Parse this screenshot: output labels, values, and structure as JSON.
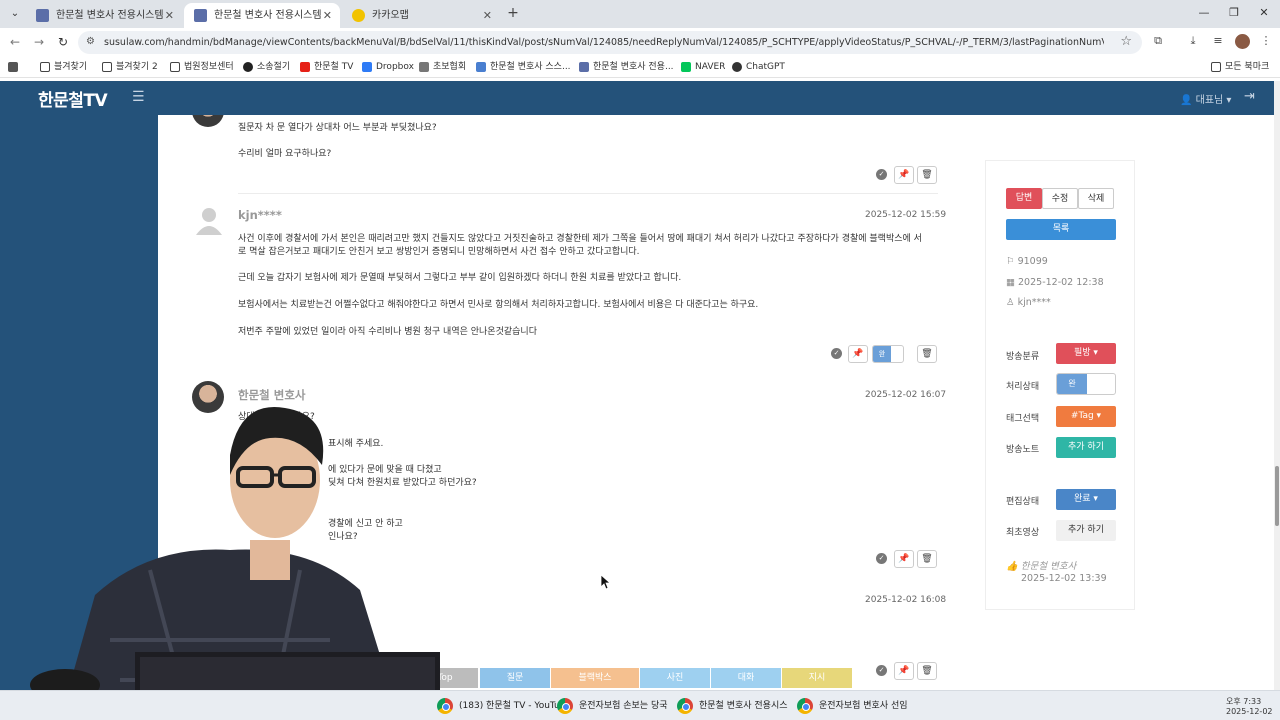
{
  "browser": {
    "tabs": [
      {
        "label": "한문철 변호사 전용시스템",
        "active": false
      },
      {
        "label": "한문철 변호사 전용시스템",
        "active": true
      },
      {
        "label": "카카오맵",
        "active": false
      }
    ],
    "url": "susulaw.com/handmin/bdManage/viewContents/backMenuVal/B/bdSelVal/11/thisKindVal/post/sNumVal/124085/needReplyNumVal/124085/P_SCHTYPE/applyVideoStatus/P_SCHVAL/-/P_TERM/3/lastPaginationNumVal/1",
    "bookmarks": [
      "블겨찾기",
      "블겨찾기 2",
      "법원정보센터",
      "소송절기",
      "한문철 TV",
      "Dropbox",
      "초보협회",
      "한문철 변호사 스스...",
      "한문철 변호사 전용...",
      "NAVER",
      "ChatGPT"
    ],
    "bookmarks_right": "모든 북마크"
  },
  "site": {
    "logo": "한문철TV",
    "user": "대표님 ▾"
  },
  "comments": {
    "prev": {
      "lines": [
        "질문자 차 문 열다가 상대차 어느 부분과 부딪쳤나요?",
        "수리비 얼마 요구하나요?"
      ]
    },
    "c1": {
      "author": "kjn****",
      "date": "2025-12-02 15:59",
      "lines": [
        "사건 이후에 경찰서에 가서 본인은 때리려고만 했지 건들지도 않았다고 거짓진술하고 경찰한테 제가 그쪽을 들어서 땅에 패대기 쳐서 허리가 나갔다고 주장하다가 경찰에 블랙박스에 서",
        "로 멱살 잡은거보고 패대기도 안친거 보고 쌍방인거 증명되니 민망해하면서 사건 접수 안하고 갔다고합니다.",
        "근데 오늘 갑자기 보험사에 제가 문열때 부딪혀서 그렇다고 부부 같이 입원하겠다 하더니 한원 치료를 받았다고 합니다.",
        "보험사에서는 치료받는건 어쩔수없다고 해줘야한다고 하면서 민사로 항의해서 처리하자고합니다. 보험사에서 비용은 다 대준다고는 하구요.",
        "저번주 주말에 있었던 일이라 아직 수리비나 병원 청구 내역은 안나온것같습니다"
      ],
      "toggle_label": "완"
    },
    "c2": {
      "author": "한문철 변호사",
      "date": "2025-12-02 16:07",
      "lines": [
        "상대 부딪친 건가요?",
        "표시해 주세요.",
        "에 있다가 문에 맞을 때 다쳤고",
        "딪쳐 다쳐 한원치료 받았다고 하던가요?",
        "경찰에 신고 안 하고",
        "인나요?"
      ]
    },
    "c3": {
      "date": "2025-12-02 16:08"
    }
  },
  "panel": {
    "buttons": {
      "answer": "답변",
      "edit": "수정",
      "delete": "삭제",
      "list": "목록"
    },
    "meta": {
      "number": "91099",
      "date": "2025-12-02 12:38",
      "user": "kjn****"
    },
    "rows": [
      {
        "label": "방송분류",
        "value": "필방 ▾"
      },
      {
        "label": "처리상태",
        "value": "완"
      },
      {
        "label": "태그선택",
        "value": "#Tag ▾"
      },
      {
        "label": "방송노트",
        "value": "추가 하기"
      },
      {
        "label": "편집상태",
        "value": "완료 ▾"
      },
      {
        "label": "최초영상",
        "value": "추가 하기"
      }
    ],
    "footer_author": "한문철 변호사",
    "footer_date": "2025-12-02 13:39"
  },
  "category_tabs": [
    "Top",
    "질문",
    "블랙박스",
    "사진",
    "대화",
    "지시"
  ],
  "category_colors": [
    "#bcbcbc",
    "#8fc3ea",
    "#f5c08f",
    "#9ed0f0",
    "#9ed0f0",
    "#e7d77a"
  ],
  "taskbar": {
    "items": [
      "(183) 한문철 TV - YouTu",
      "운전자보험 손보는 당국",
      "한문철 변호사 전용시스",
      "운전자보험 변호사 선임"
    ],
    "time": "오후 7:33",
    "date": "2025-12-02"
  }
}
